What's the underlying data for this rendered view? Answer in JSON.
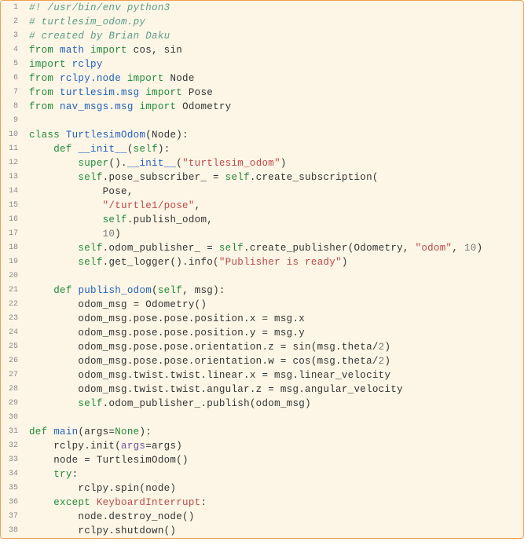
{
  "code": {
    "lines": [
      [
        {
          "cls": "tok-comment",
          "t": "#! /usr/bin/env python3"
        }
      ],
      [
        {
          "cls": "tok-comment",
          "t": "# turtlesim_odom.py"
        }
      ],
      [
        {
          "cls": "tok-comment",
          "t": "# created by Brian Daku"
        }
      ],
      [
        {
          "cls": "tok-keyword",
          "t": "from "
        },
        {
          "cls": "tok-def",
          "t": "math"
        },
        {
          "cls": "tok-keyword",
          "t": " import "
        },
        {
          "cls": "tok-name",
          "t": "cos, sin"
        }
      ],
      [
        {
          "cls": "tok-keyword",
          "t": "import "
        },
        {
          "cls": "tok-def",
          "t": "rclpy"
        }
      ],
      [
        {
          "cls": "tok-keyword",
          "t": "from "
        },
        {
          "cls": "tok-def",
          "t": "rclpy.node"
        },
        {
          "cls": "tok-keyword",
          "t": " import "
        },
        {
          "cls": "tok-name",
          "t": "Node"
        }
      ],
      [
        {
          "cls": "tok-keyword",
          "t": "from "
        },
        {
          "cls": "tok-def",
          "t": "turtlesim.msg"
        },
        {
          "cls": "tok-keyword",
          "t": " import "
        },
        {
          "cls": "tok-name",
          "t": "Pose"
        }
      ],
      [
        {
          "cls": "tok-keyword",
          "t": "from "
        },
        {
          "cls": "tok-def",
          "t": "nav_msgs.msg"
        },
        {
          "cls": "tok-keyword",
          "t": " import "
        },
        {
          "cls": "tok-name",
          "t": "Odometry"
        }
      ],
      [],
      [
        {
          "cls": "tok-keyword",
          "t": "class "
        },
        {
          "cls": "tok-def",
          "t": "TurtlesimOdom"
        },
        {
          "cls": "tok-name",
          "t": "(Node):"
        }
      ],
      [
        {
          "cls": "tok-name",
          "t": "    "
        },
        {
          "cls": "tok-keyword",
          "t": "def "
        },
        {
          "cls": "tok-def",
          "t": "__init__"
        },
        {
          "cls": "tok-name",
          "t": "("
        },
        {
          "cls": "tok-self",
          "t": "self"
        },
        {
          "cls": "tok-name",
          "t": "):"
        }
      ],
      [
        {
          "cls": "tok-name",
          "t": "        "
        },
        {
          "cls": "tok-builtin",
          "t": "super"
        },
        {
          "cls": "tok-name",
          "t": "()."
        },
        {
          "cls": "tok-def",
          "t": "__init__"
        },
        {
          "cls": "tok-name",
          "t": "("
        },
        {
          "cls": "tok-string",
          "t": "\"turtlesim_odom\""
        },
        {
          "cls": "tok-name",
          "t": ")"
        }
      ],
      [
        {
          "cls": "tok-name",
          "t": "        "
        },
        {
          "cls": "tok-self",
          "t": "self"
        },
        {
          "cls": "tok-name",
          "t": ".pose_subscriber_ = "
        },
        {
          "cls": "tok-self",
          "t": "self"
        },
        {
          "cls": "tok-name",
          "t": ".create_subscription("
        }
      ],
      [
        {
          "cls": "tok-name",
          "t": "            Pose,"
        }
      ],
      [
        {
          "cls": "tok-name",
          "t": "            "
        },
        {
          "cls": "tok-string",
          "t": "\"/turtle1/pose\""
        },
        {
          "cls": "tok-name",
          "t": ","
        }
      ],
      [
        {
          "cls": "tok-name",
          "t": "            "
        },
        {
          "cls": "tok-self",
          "t": "self"
        },
        {
          "cls": "tok-name",
          "t": ".publish_odom,"
        }
      ],
      [
        {
          "cls": "tok-name",
          "t": "            "
        },
        {
          "cls": "tok-number",
          "t": "10"
        },
        {
          "cls": "tok-name",
          "t": ")"
        }
      ],
      [
        {
          "cls": "tok-name",
          "t": "        "
        },
        {
          "cls": "tok-self",
          "t": "self"
        },
        {
          "cls": "tok-name",
          "t": ".odom_publisher_ = "
        },
        {
          "cls": "tok-self",
          "t": "self"
        },
        {
          "cls": "tok-name",
          "t": ".create_publisher(Odometry, "
        },
        {
          "cls": "tok-string",
          "t": "\"odom\""
        },
        {
          "cls": "tok-name",
          "t": ", "
        },
        {
          "cls": "tok-number",
          "t": "10"
        },
        {
          "cls": "tok-name",
          "t": ")"
        }
      ],
      [
        {
          "cls": "tok-name",
          "t": "        "
        },
        {
          "cls": "tok-self",
          "t": "self"
        },
        {
          "cls": "tok-name",
          "t": ".get_logger().info("
        },
        {
          "cls": "tok-string",
          "t": "\"Publisher is ready\""
        },
        {
          "cls": "tok-name",
          "t": ")"
        }
      ],
      [],
      [
        {
          "cls": "tok-name",
          "t": "    "
        },
        {
          "cls": "tok-keyword",
          "t": "def "
        },
        {
          "cls": "tok-def",
          "t": "publish_odom"
        },
        {
          "cls": "tok-name",
          "t": "("
        },
        {
          "cls": "tok-self",
          "t": "self"
        },
        {
          "cls": "tok-name",
          "t": ", msg):"
        }
      ],
      [
        {
          "cls": "tok-name",
          "t": "        odom_msg = Odometry()"
        }
      ],
      [
        {
          "cls": "tok-name",
          "t": "        odom_msg.pose.pose.position.x = msg.x"
        }
      ],
      [
        {
          "cls": "tok-name",
          "t": "        odom_msg.pose.pose.position.y = msg.y"
        }
      ],
      [
        {
          "cls": "tok-name",
          "t": "        odom_msg.pose.pose.orientation.z = sin(msg.theta/"
        },
        {
          "cls": "tok-number",
          "t": "2"
        },
        {
          "cls": "tok-name",
          "t": ")"
        }
      ],
      [
        {
          "cls": "tok-name",
          "t": "        odom_msg.pose.pose.orientation.w = cos(msg.theta/"
        },
        {
          "cls": "tok-number",
          "t": "2"
        },
        {
          "cls": "tok-name",
          "t": ")"
        }
      ],
      [
        {
          "cls": "tok-name",
          "t": "        odom_msg.twist.twist.linear.x = msg.linear_velocity"
        }
      ],
      [
        {
          "cls": "tok-name",
          "t": "        odom_msg.twist.twist.angular.z = msg.angular_velocity"
        }
      ],
      [
        {
          "cls": "tok-name",
          "t": "        "
        },
        {
          "cls": "tok-self",
          "t": "self"
        },
        {
          "cls": "tok-name",
          "t": ".odom_publisher_.publish(odom_msg)"
        }
      ],
      [],
      [
        {
          "cls": "tok-keyword",
          "t": "def "
        },
        {
          "cls": "tok-def",
          "t": "main"
        },
        {
          "cls": "tok-name",
          "t": "(args="
        },
        {
          "cls": "tok-builtin",
          "t": "None"
        },
        {
          "cls": "tok-name",
          "t": "):"
        }
      ],
      [
        {
          "cls": "tok-name",
          "t": "    rclpy.init("
        },
        {
          "cls": "tok-kwarg",
          "t": "args"
        },
        {
          "cls": "tok-name",
          "t": "=args)"
        }
      ],
      [
        {
          "cls": "tok-name",
          "t": "    node = TurtlesimOdom()"
        }
      ],
      [
        {
          "cls": "tok-name",
          "t": "    "
        },
        {
          "cls": "tok-keyword",
          "t": "try"
        },
        {
          "cls": "tok-name",
          "t": ":"
        }
      ],
      [
        {
          "cls": "tok-name",
          "t": "        rclpy.spin(node)"
        }
      ],
      [
        {
          "cls": "tok-name",
          "t": "    "
        },
        {
          "cls": "tok-keyword",
          "t": "except "
        },
        {
          "cls": "tok-exc",
          "t": "KeyboardInterrupt"
        },
        {
          "cls": "tok-name",
          "t": ":"
        }
      ],
      [
        {
          "cls": "tok-name",
          "t": "        node.destroy_node()"
        }
      ],
      [
        {
          "cls": "tok-name",
          "t": "        rclpy.shutdown()"
        }
      ]
    ]
  }
}
